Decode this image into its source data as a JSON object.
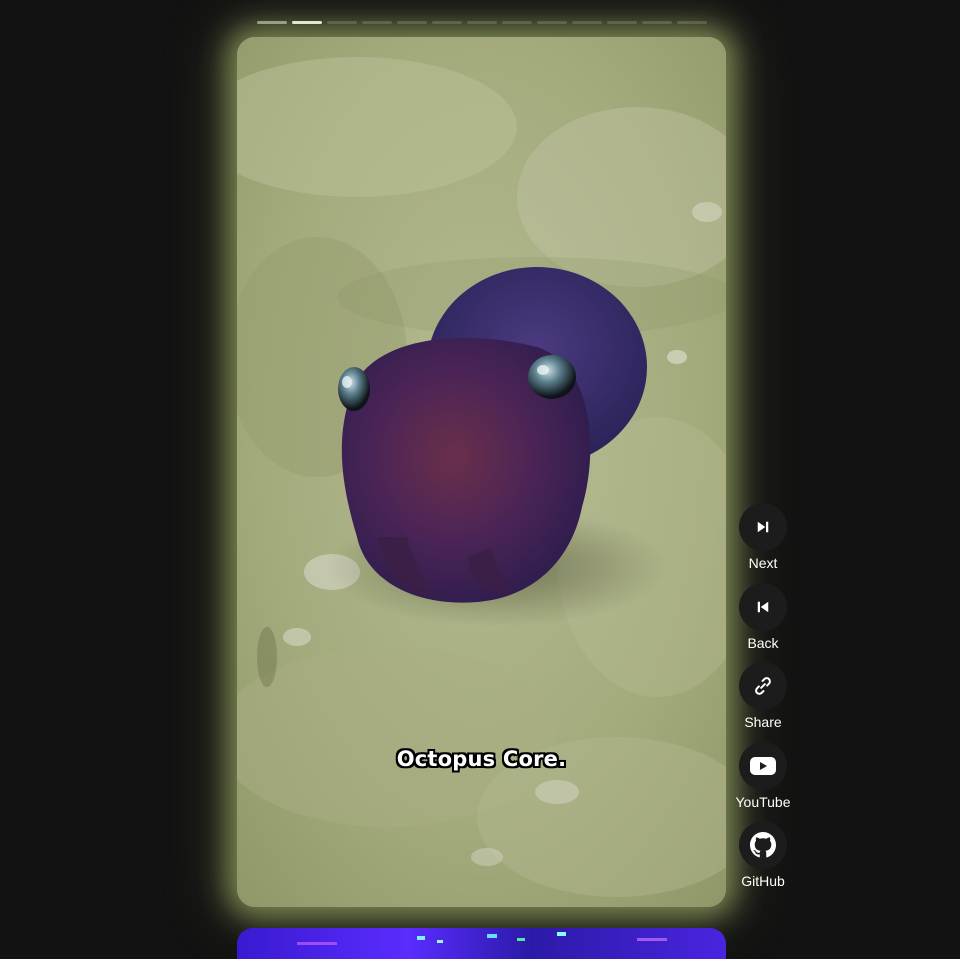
{
  "progress": {
    "segments": 13,
    "active_index": 1
  },
  "video": {
    "caption": "Octopus Core."
  },
  "actions": [
    {
      "label": "Next",
      "icon": "skip-next-icon"
    },
    {
      "label": "Back",
      "icon": "skip-previous-icon"
    },
    {
      "label": "Share",
      "icon": "link-icon"
    },
    {
      "label": "YouTube",
      "icon": "youtube-icon"
    },
    {
      "label": "GitHub",
      "icon": "github-icon"
    }
  ],
  "colors": {
    "background": "#121212",
    "card_glow": "#c6d882",
    "button_bg": "#1c1c1c",
    "progress_active": "#f2f2f2",
    "progress_done": "#8d8d8d",
    "progress_pending": "#3a3a3a"
  }
}
